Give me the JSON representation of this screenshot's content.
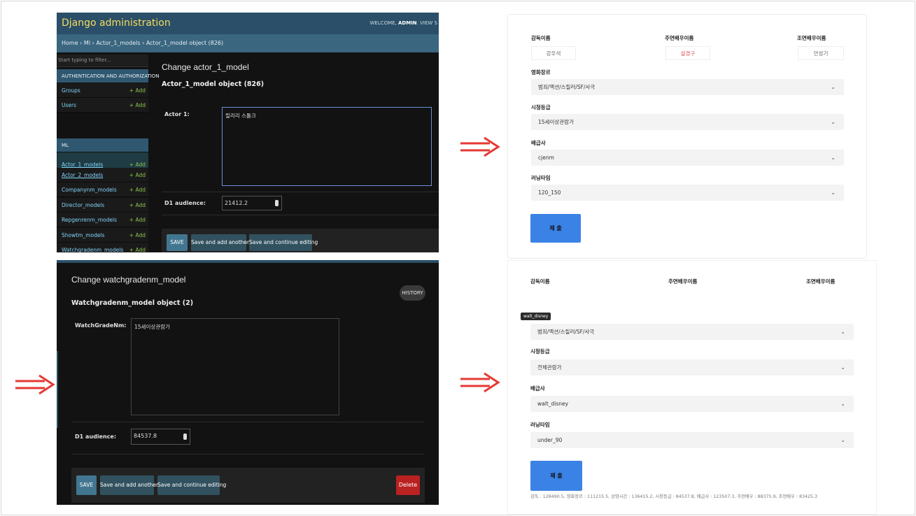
{
  "colors": {
    "accent_red": "#e53935",
    "django_yellow": "#f5dd5d",
    "link_blue": "#81d4fa",
    "add_green": "#8bc34a",
    "submit_blue": "#3b82e6"
  },
  "arrow_icon": "double-right-arrow-icon",
  "django1": {
    "brand": "Django administration",
    "welcome_prefix": "WELCOME, ",
    "welcome_user": "ADMIN",
    "welcome_suffix": ". VIEW S",
    "breadcrumb": "Home › Ml › Actor_1_models › Actor_1_model object (826)",
    "filter_placeholder": "Start typing to filter...",
    "auth_caption": "AUTHENTICATION AND AUTHORIZATION",
    "auth_items": [
      {
        "label": "Groups",
        "add": "+ Add"
      },
      {
        "label": "Users",
        "add": "+ Add"
      }
    ],
    "ml_caption": "ML",
    "ml_items": [
      {
        "label": "Actor_1_models",
        "add": "+ Add"
      },
      {
        "label": "Actor_2_models",
        "add": "+ Add"
      },
      {
        "label": "Companynm_models",
        "add": "+ Add"
      },
      {
        "label": "Director_models",
        "add": "+ Add"
      },
      {
        "label": "Repgenrenm_models",
        "add": "+ Add"
      },
      {
        "label": "Showtm_models",
        "add": "+ Add"
      },
      {
        "label": "Watchgradenm_models",
        "add": "+ Add"
      }
    ],
    "title": "Change actor_1_model",
    "object": "Actor_1_model object (826)",
    "field_label": "Actor 1:",
    "field_value": "릴리리 스톨크",
    "audience_label": "D1 audience:",
    "audience_value": "21412.2",
    "save": "SAVE",
    "save_add": "Save and add another",
    "save_continue": "Save and continue editing"
  },
  "django2": {
    "title": "Change watchgradenm_model",
    "history": "HISTORY",
    "object": "Watchgradenm_model object (2)",
    "field_label": "WatchGradeNm:",
    "field_value": "15세이상관람가",
    "audience_label": "D1 audience:",
    "audience_value": "84537.8",
    "save": "SAVE",
    "save_add": "Save and add another",
    "save_continue": "Save and continue editing",
    "delete": "Delete"
  },
  "form1": {
    "director_label": "감독이름",
    "director_value": "강우석",
    "lead_label": "주연배우이름",
    "lead_value": "설경구",
    "support_label": "조연배우이름",
    "support_value": "안성기",
    "genre_label": "영화장르",
    "genre_value": "범죄/액션/스릴러/SF/사극",
    "grade_label": "시청등급",
    "grade_value": "15세이상관람가",
    "distributor_label": "배급사",
    "distributor_value": "cjenm",
    "runtime_label": "러닝타임",
    "runtime_value": "120_150",
    "submit": "제 출"
  },
  "form2": {
    "director_label": "감독이름",
    "lead_label": "주연배우이름",
    "support_label": "조연배우이름",
    "tooltip": "walt_disney",
    "genre_value": "범죄/액션/스릴러/SF/사극",
    "grade_label": "시청등급",
    "grade_value": "전체관람가",
    "distributor_label": "배급사",
    "distributor_value": "walt_disney",
    "runtime_label": "러닝타임",
    "runtime_value": "under_90",
    "submit": "제 출",
    "result": "감독 : 128490.5, 영화장르 : 111215.5, 상영시간 : 136415.2, 시청등급 : 84537.8, 배급사 : 123507.3, 주연배우 : 88375.9, 조연배우 : 83425.3"
  }
}
